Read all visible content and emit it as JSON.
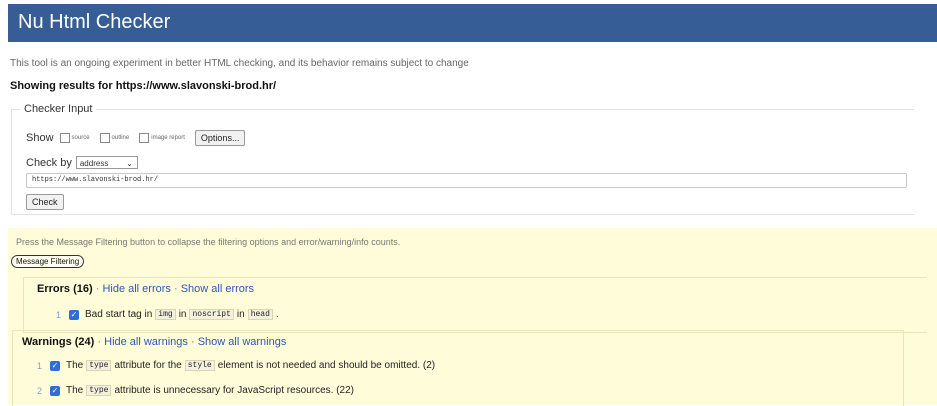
{
  "header": {
    "title": "Nu Html Checker"
  },
  "intro": "This tool is an ongoing experiment in better HTML checking, and its behavior remains subject to change",
  "showing": "Showing results for https://www.slavonski-brod.hr/",
  "checker_input": {
    "legend": "Checker Input",
    "show_label": "Show",
    "options": [
      "source",
      "outline",
      "image report"
    ],
    "options_button": "Options...",
    "check_by_label": "Check by",
    "check_by_value": "address",
    "url_value": "https://www.slavonski-brod.hr/",
    "check_button": "Check"
  },
  "filtering": {
    "text": "Press the Message Filtering button to collapse the filtering options and error/warning/info counts.",
    "button": "Message Filtering"
  },
  "errors": {
    "title": "Errors (16)",
    "hide_link": "Hide all errors",
    "show_link": "Show all errors",
    "separator": "·",
    "items": [
      {
        "num": "1",
        "p1": "Bad start tag in",
        "c1": "img",
        "p2": "in",
        "c2": "noscript",
        "p3": "in",
        "c3": "head",
        "p4": "."
      }
    ]
  },
  "warnings": {
    "title": "Warnings (24)",
    "hide_link": "Hide all warnings",
    "show_link": "Show all warnings",
    "separator": "·",
    "items": [
      {
        "num": "1",
        "p1": "The",
        "c1": "type",
        "p2": "attribute for the",
        "c2": "style",
        "p3": "element is not needed and should be omitted. (2)"
      },
      {
        "num": "2",
        "p1": "The",
        "c1": "type",
        "p2": "attribute is unnecessary for JavaScript resources. (22)"
      }
    ]
  },
  "colors": {
    "header_bg": "#365d95",
    "filter_bg": "#fffcd9",
    "link": "#2f57b5",
    "checkbox": "#2d6fd6"
  }
}
